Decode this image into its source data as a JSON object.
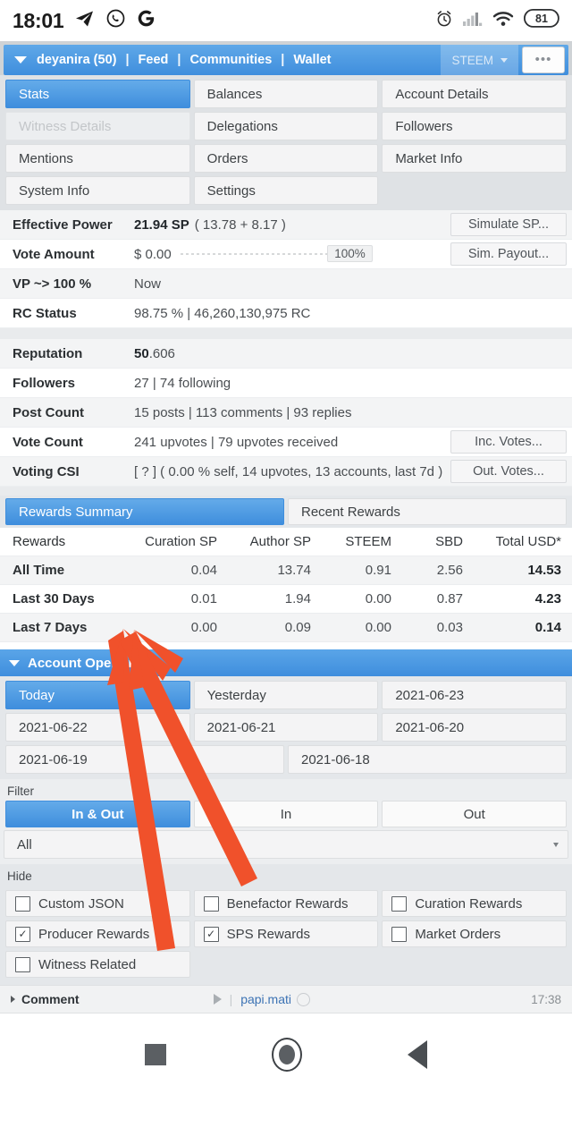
{
  "status_bar": {
    "time": "18:01",
    "left_icons": [
      "telegram-icon",
      "whatsapp-icon",
      "google-icon"
    ],
    "right_icons": [
      "alarm-icon",
      "signal-icon",
      "wifi-icon"
    ],
    "battery": "81"
  },
  "app_header": {
    "account": "deyanira (50)",
    "sep": "|",
    "links": [
      "Feed",
      "Communities",
      "Wallet"
    ],
    "token_selector": "STEEM",
    "overflow": "•••"
  },
  "tabs": [
    {
      "label": "Stats",
      "state": "active"
    },
    {
      "label": "Balances",
      "state": "normal"
    },
    {
      "label": "Account Details",
      "state": "normal"
    },
    {
      "label": "Witness Details",
      "state": "disabled"
    },
    {
      "label": "Delegations",
      "state": "normal"
    },
    {
      "label": "Followers",
      "state": "normal"
    },
    {
      "label": "Mentions",
      "state": "normal"
    },
    {
      "label": "Orders",
      "state": "normal"
    },
    {
      "label": "Market Info",
      "state": "normal"
    },
    {
      "label": "System Info",
      "state": "normal"
    },
    {
      "label": "Settings",
      "state": "normal"
    }
  ],
  "stats_top": [
    {
      "label": "Effective Power",
      "value_bold": "21.94 SP",
      "value_rest": "( 13.78 + 8.17 )",
      "button": "Simulate SP...",
      "shade": true
    },
    {
      "label": "Vote Amount",
      "value_bold": "$ 0.00",
      "value_rest": "",
      "slider_pct": "100%",
      "button": "Sim. Payout...",
      "shade": false
    },
    {
      "label": "VP ~> 100 %",
      "value_bold": "",
      "value_rest": "Now",
      "button": "",
      "shade": true
    },
    {
      "label": "RC Status",
      "value_bold": "",
      "value_rest": "98.75 %  |  46,260,130,975 RC",
      "button": "",
      "shade": false
    }
  ],
  "stats_bottom": [
    {
      "label": "Reputation",
      "value_bold": "50",
      "value_rest": ".606",
      "button": "",
      "shade": true
    },
    {
      "label": "Followers",
      "value_bold": "",
      "value_rest": "27  |  74 following",
      "button": "",
      "shade": false
    },
    {
      "label": "Post Count",
      "value_bold": "",
      "value_rest": "15 posts  |  113 comments  |  93 replies",
      "button": "",
      "shade": true
    },
    {
      "label": "Vote Count",
      "value_bold": "",
      "value_rest": "241 upvotes  |  79 upvotes received",
      "button": "Inc. Votes...",
      "shade": false
    },
    {
      "label": "Voting CSI",
      "value_bold": "",
      "value_rest": "[ ? ] ( 0.00 % self, 14 upvotes, 13 accounts, last 7d )",
      "button": "Out. Votes...",
      "shade": true
    }
  ],
  "rewards": {
    "tabs": [
      {
        "label": "Rewards Summary",
        "state": "active"
      },
      {
        "label": "Recent Rewards",
        "state": "normal"
      }
    ],
    "columns": [
      "Rewards",
      "Curation SP",
      "Author SP",
      "STEEM",
      "SBD",
      "Total USD*"
    ],
    "rows": [
      {
        "label": "All Time",
        "values": [
          "0.04",
          "13.74",
          "0.91",
          "2.56"
        ],
        "total": "14.53"
      },
      {
        "label": "Last 30 Days",
        "values": [
          "0.01",
          "1.94",
          "0.00",
          "0.87"
        ],
        "total": "4.23"
      },
      {
        "label": "Last 7 Days",
        "values": [
          "0.00",
          "0.09",
          "0.00",
          "0.03"
        ],
        "total": "0.14"
      }
    ]
  },
  "account_operations": {
    "title": "Account Operations",
    "dates": [
      {
        "label": "Today",
        "state": "active"
      },
      {
        "label": "Yesterday",
        "state": "normal"
      },
      {
        "label": "2021-06-23",
        "state": "normal"
      },
      {
        "label": "2021-06-22",
        "state": "normal"
      },
      {
        "label": "2021-06-21",
        "state": "normal"
      },
      {
        "label": "2021-06-20",
        "state": "normal"
      },
      {
        "label": "2021-06-19",
        "state": "normal"
      },
      {
        "label": "2021-06-18",
        "state": "normal"
      }
    ]
  },
  "filter": {
    "title": "Filter",
    "segments": [
      {
        "label": "In & Out",
        "state": "active"
      },
      {
        "label": "In",
        "state": "normal"
      },
      {
        "label": "Out",
        "state": "normal"
      }
    ],
    "select_value": "All"
  },
  "hide": {
    "title": "Hide",
    "items": [
      {
        "label": "Custom JSON",
        "checked": false
      },
      {
        "label": "Benefactor Rewards",
        "checked": false
      },
      {
        "label": "Curation Rewards",
        "checked": false
      },
      {
        "label": "Producer Rewards",
        "checked": true
      },
      {
        "label": "SPS Rewards",
        "checked": true
      },
      {
        "label": "Market Orders",
        "checked": false
      },
      {
        "label": "Witness Related",
        "checked": false
      }
    ],
    "check_glyph": "✓"
  },
  "comment_row": {
    "label": "Comment",
    "divider": "|",
    "user": "papi.mati",
    "time": "17:38"
  },
  "nav_bar": {
    "buttons": [
      "recents-square-icon",
      "home-circle-icon",
      "back-triangle-icon"
    ]
  },
  "annotations": {
    "arrow_color": "#F0512B",
    "count": 2,
    "description": "two hand-drawn arrows pointing up-left toward the rewards table"
  }
}
